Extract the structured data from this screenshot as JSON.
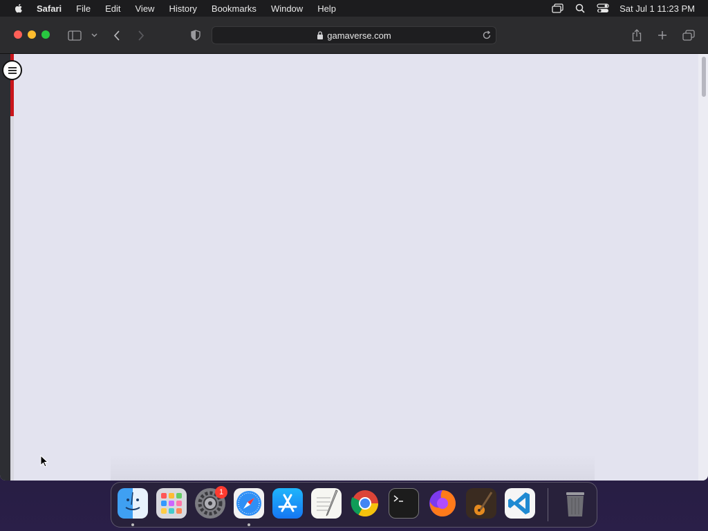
{
  "menubar": {
    "app_name": "Safari",
    "items": [
      "File",
      "Edit",
      "View",
      "History",
      "Bookmarks",
      "Window",
      "Help"
    ],
    "clock": "Sat Jul 1  11:23 PM",
    "icons": [
      "screen-mirror-icon",
      "spotlight-search-icon",
      "control-center-icon"
    ]
  },
  "browser": {
    "url": "gamaverse.com",
    "toolbar_icons": [
      "sidebar-icon",
      "chevron-down-icon",
      "back-icon",
      "forward-icon",
      "shield-icon",
      "lock-icon",
      "reload-icon",
      "share-icon",
      "new-tab-icon",
      "tab-overview-icon"
    ]
  },
  "page": {
    "menu_icon": "hamburger-menu-icon",
    "accent_color": "#c9151b",
    "background_color": "#e3e3ef"
  },
  "dock": {
    "apps": [
      {
        "name": "Finder",
        "icon": "finder-icon",
        "running": true
      },
      {
        "name": "Launchpad",
        "icon": "launchpad-icon",
        "running": false
      },
      {
        "name": "System Settings",
        "icon": "system-settings-icon",
        "running": false,
        "badge": "1"
      },
      {
        "name": "Safari",
        "icon": "safari-icon",
        "running": true
      },
      {
        "name": "App Store",
        "icon": "app-store-icon",
        "running": false
      },
      {
        "name": "TextEdit",
        "icon": "textedit-icon",
        "running": false
      },
      {
        "name": "Google Chrome",
        "icon": "chrome-icon",
        "running": false
      },
      {
        "name": "Terminal",
        "icon": "terminal-icon",
        "running": false
      },
      {
        "name": "Firefox",
        "icon": "firefox-icon",
        "running": false
      },
      {
        "name": "GarageBand",
        "icon": "garageband-icon",
        "running": false
      },
      {
        "name": "Visual Studio Code",
        "icon": "vscode-icon",
        "running": false
      },
      {
        "name": "Trash",
        "icon": "trash-icon",
        "running": false
      }
    ]
  }
}
